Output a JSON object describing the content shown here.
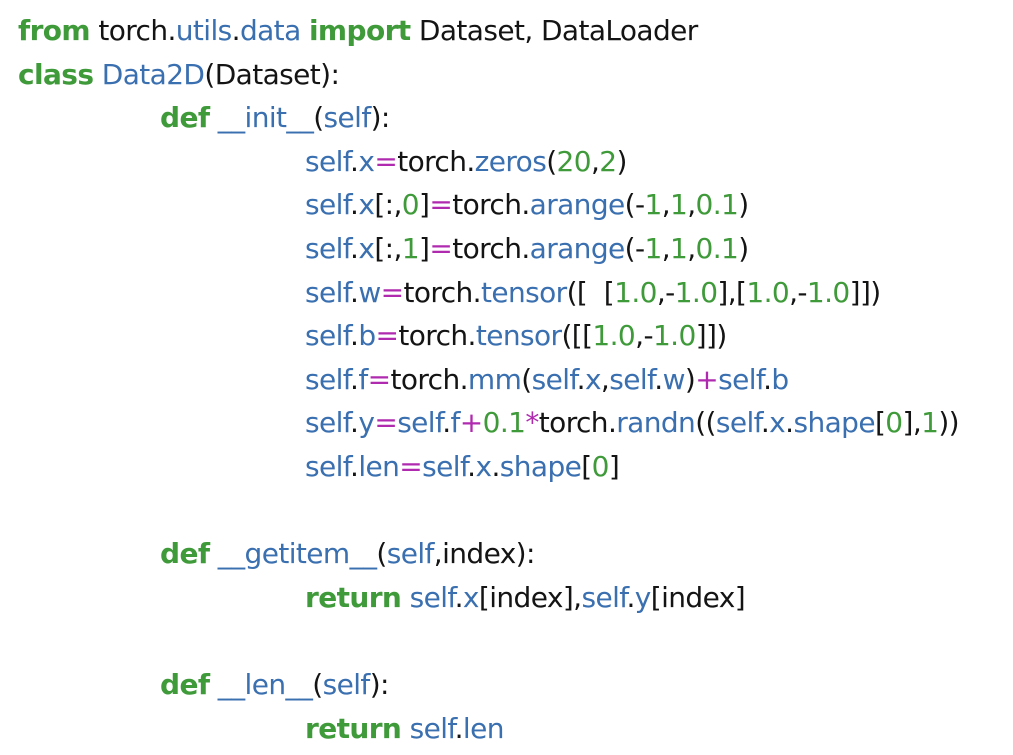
{
  "colors": {
    "keyword": "#3f9a3a",
    "identifier": "#3a6fb0",
    "number": "#3f9a3a",
    "operator": "#b02ab0",
    "text": "#141414",
    "background": "#ffffff"
  },
  "code_lines": [
    {
      "indent": 0,
      "tokens": [
        {
          "t": "from",
          "k": "kw"
        },
        {
          "t": " torch.",
          "k": "plain"
        },
        {
          "t": "utils",
          "k": "fn"
        },
        {
          "t": ".",
          "k": "plain"
        },
        {
          "t": "data",
          "k": "fn"
        },
        {
          "t": " ",
          "k": "plain"
        },
        {
          "t": "import",
          "k": "kw"
        },
        {
          "t": " Dataset, DataLoader",
          "k": "plain"
        }
      ]
    },
    {
      "indent": 0,
      "tokens": [
        {
          "t": "class",
          "k": "kw"
        },
        {
          "t": " ",
          "k": "plain"
        },
        {
          "t": "Data2D",
          "k": "fn"
        },
        {
          "t": "(Dataset):",
          "k": "plain"
        }
      ]
    },
    {
      "indent": 1,
      "tokens": [
        {
          "t": "def",
          "k": "kw"
        },
        {
          "t": " ",
          "k": "plain"
        },
        {
          "t": "__init__",
          "k": "fn"
        },
        {
          "t": "(",
          "k": "plain"
        },
        {
          "t": "self",
          "k": "self"
        },
        {
          "t": "):",
          "k": "plain"
        }
      ]
    },
    {
      "indent": 2,
      "tokens": [
        {
          "t": "self",
          "k": "self"
        },
        {
          "t": ".",
          "k": "plain"
        },
        {
          "t": "x",
          "k": "attr"
        },
        {
          "t": "=",
          "k": "op"
        },
        {
          "t": "torch.",
          "k": "plain"
        },
        {
          "t": "zeros",
          "k": "fn"
        },
        {
          "t": "(",
          "k": "plain"
        },
        {
          "t": "20",
          "k": "num"
        },
        {
          "t": ",",
          "k": "plain"
        },
        {
          "t": "2",
          "k": "num"
        },
        {
          "t": ")",
          "k": "plain"
        }
      ]
    },
    {
      "indent": 2,
      "tokens": [
        {
          "t": "self",
          "k": "self"
        },
        {
          "t": ".",
          "k": "plain"
        },
        {
          "t": "x",
          "k": "attr"
        },
        {
          "t": "[:,",
          "k": "plain"
        },
        {
          "t": "0",
          "k": "num"
        },
        {
          "t": "]",
          "k": "plain"
        },
        {
          "t": "=",
          "k": "op"
        },
        {
          "t": "torch.",
          "k": "plain"
        },
        {
          "t": "arange",
          "k": "fn"
        },
        {
          "t": "(-",
          "k": "plain"
        },
        {
          "t": "1",
          "k": "num"
        },
        {
          "t": ",",
          "k": "plain"
        },
        {
          "t": "1",
          "k": "num"
        },
        {
          "t": ",",
          "k": "plain"
        },
        {
          "t": "0.1",
          "k": "num"
        },
        {
          "t": ")",
          "k": "plain"
        }
      ]
    },
    {
      "indent": 2,
      "tokens": [
        {
          "t": "self",
          "k": "self"
        },
        {
          "t": ".",
          "k": "plain"
        },
        {
          "t": "x",
          "k": "attr"
        },
        {
          "t": "[:,",
          "k": "plain"
        },
        {
          "t": "1",
          "k": "num"
        },
        {
          "t": "]",
          "k": "plain"
        },
        {
          "t": "=",
          "k": "op"
        },
        {
          "t": "torch.",
          "k": "plain"
        },
        {
          "t": "arange",
          "k": "fn"
        },
        {
          "t": "(-",
          "k": "plain"
        },
        {
          "t": "1",
          "k": "num"
        },
        {
          "t": ",",
          "k": "plain"
        },
        {
          "t": "1",
          "k": "num"
        },
        {
          "t": ",",
          "k": "plain"
        },
        {
          "t": "0.1",
          "k": "num"
        },
        {
          "t": ")",
          "k": "plain"
        }
      ]
    },
    {
      "indent": 2,
      "tokens": [
        {
          "t": "self",
          "k": "self"
        },
        {
          "t": ".",
          "k": "plain"
        },
        {
          "t": "w",
          "k": "attr"
        },
        {
          "t": "=",
          "k": "op"
        },
        {
          "t": "torch.",
          "k": "plain"
        },
        {
          "t": "tensor",
          "k": "fn"
        },
        {
          "t": "([  [",
          "k": "plain"
        },
        {
          "t": "1.0",
          "k": "num"
        },
        {
          "t": ",-",
          "k": "plain"
        },
        {
          "t": "1.0",
          "k": "num"
        },
        {
          "t": "],[",
          "k": "plain"
        },
        {
          "t": "1.0",
          "k": "num"
        },
        {
          "t": ",-",
          "k": "plain"
        },
        {
          "t": "1.0",
          "k": "num"
        },
        {
          "t": "]])",
          "k": "plain"
        }
      ]
    },
    {
      "indent": 2,
      "tokens": [
        {
          "t": "self",
          "k": "self"
        },
        {
          "t": ".",
          "k": "plain"
        },
        {
          "t": "b",
          "k": "attr"
        },
        {
          "t": "=",
          "k": "op"
        },
        {
          "t": "torch.",
          "k": "plain"
        },
        {
          "t": "tensor",
          "k": "fn"
        },
        {
          "t": "([[",
          "k": "plain"
        },
        {
          "t": "1.0",
          "k": "num"
        },
        {
          "t": ",-",
          "k": "plain"
        },
        {
          "t": "1.0",
          "k": "num"
        },
        {
          "t": "]])",
          "k": "plain"
        }
      ]
    },
    {
      "indent": 2,
      "tokens": [
        {
          "t": "self",
          "k": "self"
        },
        {
          "t": ".",
          "k": "plain"
        },
        {
          "t": "f",
          "k": "attr"
        },
        {
          "t": "=",
          "k": "op"
        },
        {
          "t": "torch.",
          "k": "plain"
        },
        {
          "t": "mm",
          "k": "fn"
        },
        {
          "t": "(",
          "k": "plain"
        },
        {
          "t": "self",
          "k": "self"
        },
        {
          "t": ".",
          "k": "plain"
        },
        {
          "t": "x",
          "k": "attr"
        },
        {
          "t": ",",
          "k": "plain"
        },
        {
          "t": "self",
          "k": "self"
        },
        {
          "t": ".",
          "k": "plain"
        },
        {
          "t": "w",
          "k": "attr"
        },
        {
          "t": ")",
          "k": "plain"
        },
        {
          "t": "+",
          "k": "op"
        },
        {
          "t": "self",
          "k": "self"
        },
        {
          "t": ".",
          "k": "plain"
        },
        {
          "t": "b",
          "k": "attr"
        }
      ]
    },
    {
      "indent": 2,
      "tokens": [
        {
          "t": "self",
          "k": "self"
        },
        {
          "t": ".",
          "k": "plain"
        },
        {
          "t": "y",
          "k": "attr"
        },
        {
          "t": "=",
          "k": "op"
        },
        {
          "t": "self",
          "k": "self"
        },
        {
          "t": ".",
          "k": "plain"
        },
        {
          "t": "f",
          "k": "attr"
        },
        {
          "t": "+",
          "k": "op"
        },
        {
          "t": "0.1",
          "k": "num"
        },
        {
          "t": "*",
          "k": "op"
        },
        {
          "t": "torch.",
          "k": "plain"
        },
        {
          "t": "randn",
          "k": "fn"
        },
        {
          "t": "((",
          "k": "plain"
        },
        {
          "t": "self",
          "k": "self"
        },
        {
          "t": ".",
          "k": "plain"
        },
        {
          "t": "x",
          "k": "attr"
        },
        {
          "t": ".",
          "k": "plain"
        },
        {
          "t": "shape",
          "k": "fn"
        },
        {
          "t": "[",
          "k": "plain"
        },
        {
          "t": "0",
          "k": "num"
        },
        {
          "t": "],",
          "k": "plain"
        },
        {
          "t": "1",
          "k": "num"
        },
        {
          "t": "))",
          "k": "plain"
        }
      ]
    },
    {
      "indent": 2,
      "tokens": [
        {
          "t": "self",
          "k": "self"
        },
        {
          "t": ".",
          "k": "plain"
        },
        {
          "t": "len",
          "k": "attr"
        },
        {
          "t": "=",
          "k": "op"
        },
        {
          "t": "self",
          "k": "self"
        },
        {
          "t": ".",
          "k": "plain"
        },
        {
          "t": "x",
          "k": "attr"
        },
        {
          "t": ".",
          "k": "plain"
        },
        {
          "t": "shape",
          "k": "fn"
        },
        {
          "t": "[",
          "k": "plain"
        },
        {
          "t": "0",
          "k": "num"
        },
        {
          "t": "]",
          "k": "plain"
        }
      ]
    },
    {
      "indent": 0,
      "tokens": []
    },
    {
      "indent": 1,
      "tokens": [
        {
          "t": "def",
          "k": "kw"
        },
        {
          "t": " ",
          "k": "plain"
        },
        {
          "t": "__getitem__",
          "k": "fn"
        },
        {
          "t": "(",
          "k": "plain"
        },
        {
          "t": "self",
          "k": "self"
        },
        {
          "t": ",index):",
          "k": "plain"
        }
      ]
    },
    {
      "indent": 2,
      "tokens": [
        {
          "t": "return",
          "k": "kw"
        },
        {
          "t": " ",
          "k": "plain"
        },
        {
          "t": "self",
          "k": "self"
        },
        {
          "t": ".",
          "k": "plain"
        },
        {
          "t": "x",
          "k": "attr"
        },
        {
          "t": "[index],",
          "k": "plain"
        },
        {
          "t": "self",
          "k": "self"
        },
        {
          "t": ".",
          "k": "plain"
        },
        {
          "t": "y",
          "k": "attr"
        },
        {
          "t": "[index]",
          "k": "plain"
        }
      ]
    },
    {
      "indent": 0,
      "tokens": []
    },
    {
      "indent": 1,
      "tokens": [
        {
          "t": "def",
          "k": "kw"
        },
        {
          "t": " ",
          "k": "plain"
        },
        {
          "t": "__len__",
          "k": "fn"
        },
        {
          "t": "(",
          "k": "plain"
        },
        {
          "t": "self",
          "k": "self"
        },
        {
          "t": "):",
          "k": "plain"
        }
      ]
    },
    {
      "indent": 2,
      "tokens": [
        {
          "t": "return",
          "k": "kw"
        },
        {
          "t": " ",
          "k": "plain"
        },
        {
          "t": "self",
          "k": "self"
        },
        {
          "t": ".",
          "k": "plain"
        },
        {
          "t": "len",
          "k": "attr"
        }
      ]
    }
  ]
}
